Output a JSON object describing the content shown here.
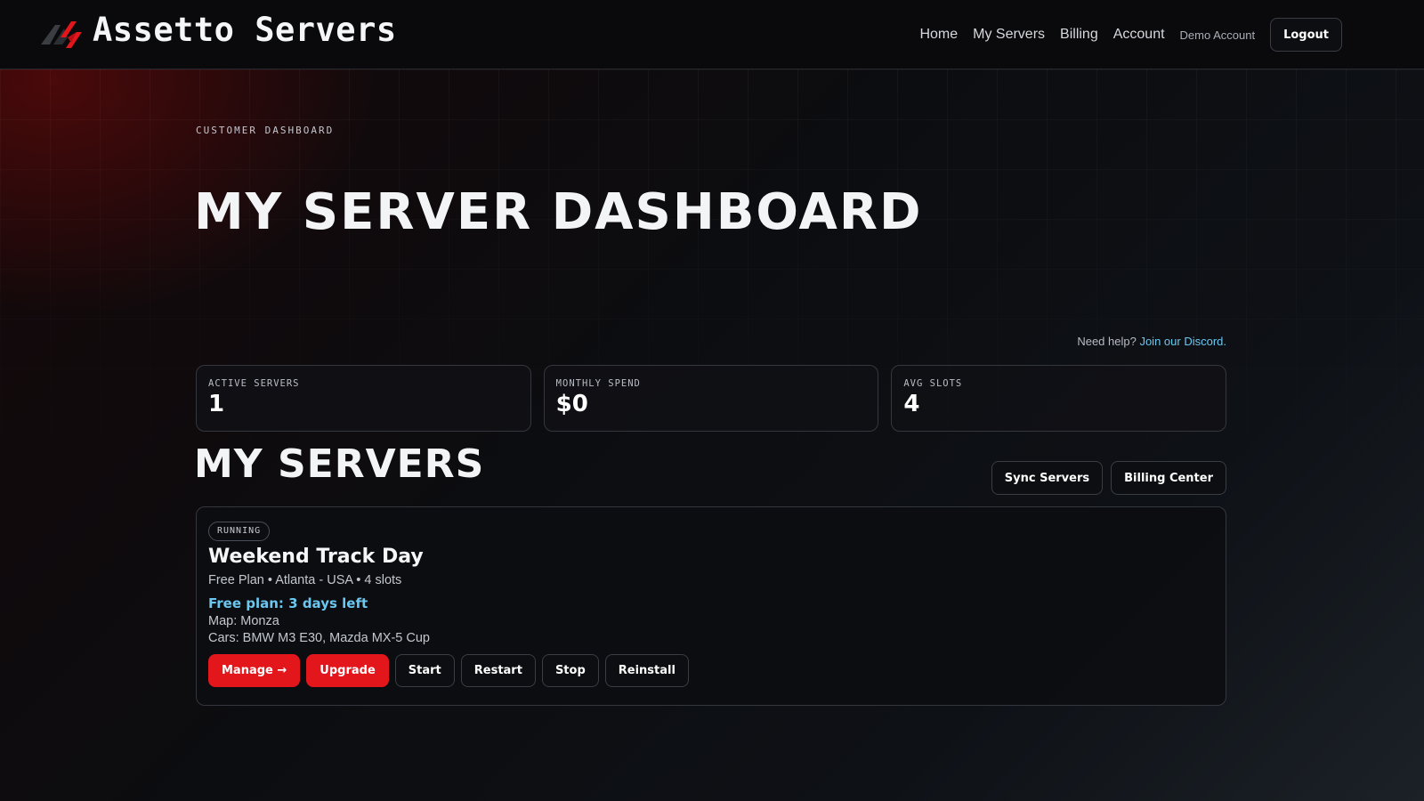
{
  "header": {
    "brand": "Assetto Servers",
    "nav": [
      {
        "label": "Home"
      },
      {
        "label": "My Servers"
      },
      {
        "label": "Billing"
      },
      {
        "label": "Account"
      }
    ],
    "user": "Demo Account",
    "logout_label": "Logout"
  },
  "hero": {
    "eyebrow": "CUSTOMER DASHBOARD",
    "title": "MY SERVER DASHBOARD"
  },
  "help": {
    "prefix": "Need help?",
    "link_label": "Join our Discord."
  },
  "stats": [
    {
      "label": "ACTIVE SERVERS",
      "value": "1"
    },
    {
      "label": "MONTHLY SPEND",
      "value": "$0"
    },
    {
      "label": "AVG SLOTS",
      "value": "4"
    }
  ],
  "servers_section": {
    "title": "MY SERVERS",
    "sync_label": "Sync Servers",
    "billing_label": "Billing Center"
  },
  "server": {
    "status": "RUNNING",
    "name": "Weekend Track Day",
    "meta": "Free Plan • Atlanta - USA • 4 slots",
    "plan_notice": "Free plan: 3 days left",
    "map": "Map: Monza",
    "cars": "Cars: BMW M3 E30, Mazda MX-5 Cup",
    "actions": {
      "manage": "Manage →",
      "upgrade": "Upgrade",
      "start": "Start",
      "restart": "Restart",
      "stop": "Stop",
      "reinstall": "Reinstall"
    }
  },
  "colors": {
    "accent_red": "#e3161c",
    "link_blue": "#6cc7f0",
    "background": "#0b0c0f"
  },
  "icons": {
    "logo": "assetto-logo-icon"
  }
}
